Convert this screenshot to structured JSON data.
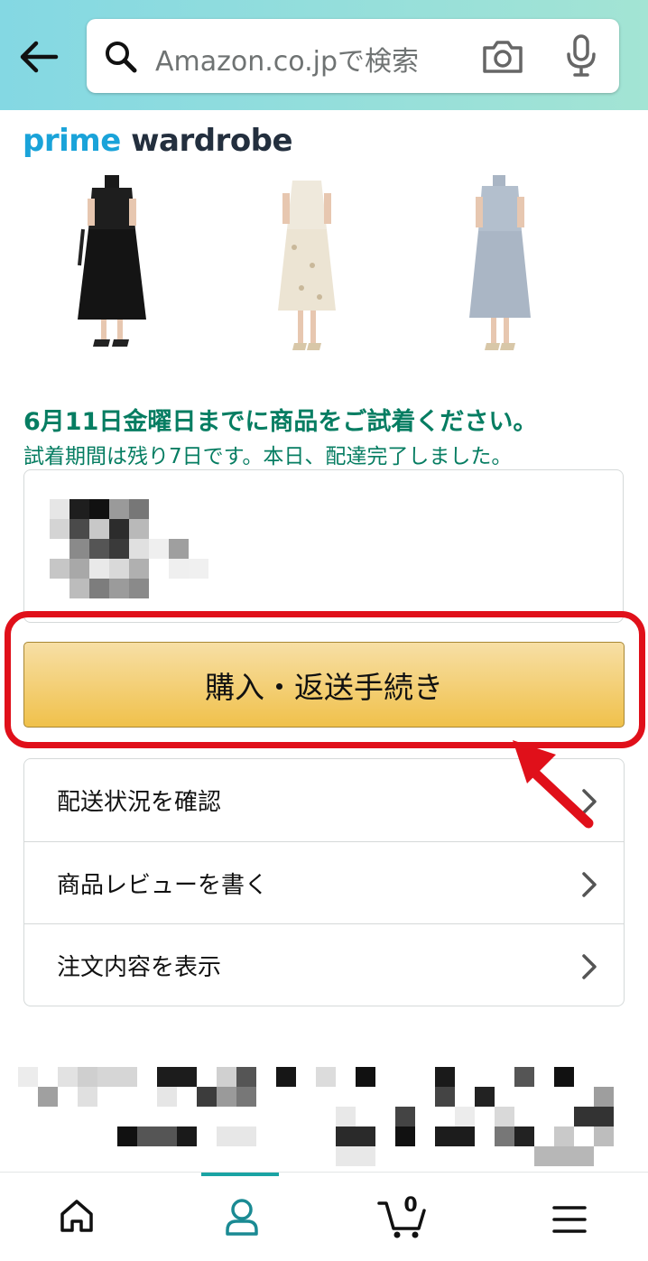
{
  "header": {
    "search_placeholder": "Amazon.co.jpで検索"
  },
  "logo": {
    "prime": "prime",
    "wardrobe": "wardrobe"
  },
  "notice": {
    "deadline": "6月11日金曜日までに商品をご試着ください。",
    "period": "試着期間は残り7日です。本日、配達完了しました。"
  },
  "buy_button": {
    "label": "購入・返送手続き"
  },
  "options": [
    {
      "label": "配送状況を確認"
    },
    {
      "label": "商品レビューを書く"
    },
    {
      "label": "注文内容を表示"
    }
  ],
  "bottom_nav": {
    "cart_count": "0"
  },
  "colors": {
    "accent_green": "#067d62",
    "button_yellow": "#f0c14b",
    "highlight_red": "#e0101a",
    "prime_blue": "#1aa3d9"
  }
}
